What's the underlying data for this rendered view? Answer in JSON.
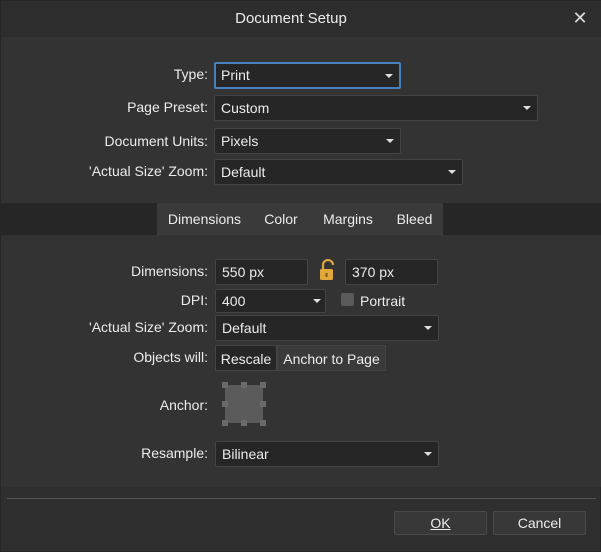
{
  "window": {
    "title": "Document Setup"
  },
  "top": {
    "type_label": "Type:",
    "type_value": "Print",
    "page_preset_label": "Page Preset:",
    "page_preset_value": "Custom",
    "units_label": "Document Units:",
    "units_value": "Pixels",
    "zoom_label": "'Actual Size' Zoom:",
    "zoom_value": "Default"
  },
  "tabs": [
    "Dimensions",
    "Color",
    "Margins",
    "Bleed"
  ],
  "dimensions": {
    "dimensions_label": "Dimensions:",
    "width_value": "550 px",
    "height_value": "370 px",
    "dpi_label": "DPI:",
    "dpi_value": "400",
    "portrait_label": "Portrait",
    "zoom_label": "'Actual Size' Zoom:",
    "zoom_value": "Default",
    "objects_label": "Objects will:",
    "objects_options": [
      "Rescale",
      "Anchor to Page"
    ],
    "anchor_label": "Anchor:",
    "resample_label": "Resample:",
    "resample_value": "Bilinear"
  },
  "footer": {
    "ok_label": "OK",
    "cancel_label": "Cancel"
  },
  "icons": {
    "close": "close-icon",
    "lock": "lock-icon",
    "anchor": "anchor-grid-icon"
  },
  "colors": {
    "focus": "#4a7fbd",
    "panel": "#333333",
    "field": "#262626"
  }
}
